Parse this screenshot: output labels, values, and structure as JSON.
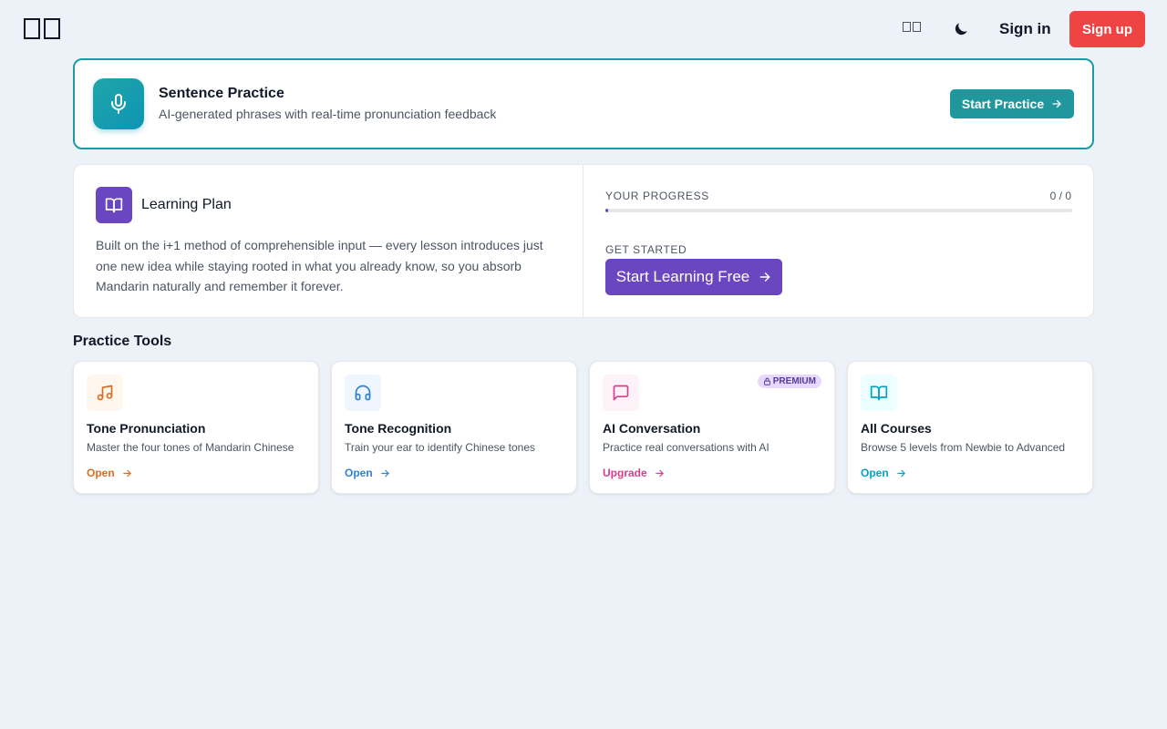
{
  "header": {
    "signin_label": "Sign in",
    "signup_label": "Sign up"
  },
  "banner": {
    "title": "Sentence Practice",
    "subtitle": "AI-generated phrases with real-time pronunciation feedback",
    "button_label": "Start Practice",
    "icon": "microphone-icon"
  },
  "plan": {
    "title": "Learning Plan",
    "description": "Built on the i+1 method of comprehensible input — every lesson introduces just one new idea while staying rooted in what you already know, so you absorb Mandarin naturally and remember it forever.",
    "progress_label": "YOUR PROGRESS",
    "progress_count": "0 / 0",
    "progress_fraction": 0,
    "get_started_label": "GET STARTED",
    "button_label": "Start Learning Free",
    "icon": "book-icon"
  },
  "tools": {
    "section_title": "Practice Tools",
    "items": [
      {
        "title": "Tone Pronunciation",
        "description": "Master the four tones of Mandarin Chinese",
        "link": "Open",
        "icon": "music-note-icon",
        "color": "#dd6b20",
        "bg": "#fff7ed"
      },
      {
        "title": "Tone Recognition",
        "description": "Train your ear to identify Chinese tones",
        "link": "Open",
        "icon": "headphones-icon",
        "color": "#3182ce",
        "bg": "#eff6ff"
      },
      {
        "title": "AI Conversation",
        "description": "Practice real conversations with AI",
        "link": "Upgrade",
        "icon": "chat-bubble-icon",
        "color": "#d53f8c",
        "bg": "#fdf2f8",
        "badge": "PREMIUM"
      },
      {
        "title": "All Courses",
        "description": "Browse 5 levels from Newbie to Advanced",
        "link": "Open",
        "icon": "open-book-icon",
        "color": "#00a3c4",
        "bg": "#ecfeff"
      }
    ]
  },
  "colors": {
    "brand_teal": "#1f979c",
    "brand_purple": "#6b46c1",
    "signup_red": "#ef4444",
    "page_bg": "#edf1f8"
  }
}
